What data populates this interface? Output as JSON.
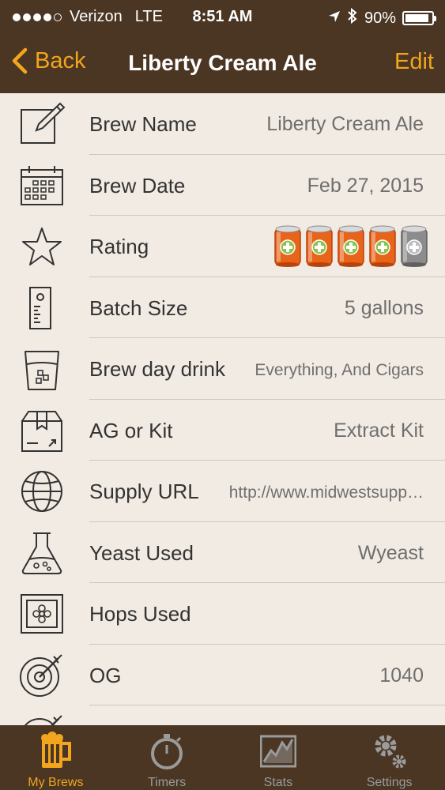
{
  "status_bar": {
    "carrier": "Verizon",
    "network": "LTE",
    "time": "8:51 AM",
    "battery": "90%",
    "battery_level": 0.9
  },
  "nav": {
    "back_label": "Back",
    "title": "Liberty Cream Ale",
    "edit_label": "Edit"
  },
  "rows": [
    {
      "label": "Brew Name",
      "value": "Liberty Cream Ale",
      "icon": "pencil-square-icon"
    },
    {
      "label": "Brew Date",
      "value": "Feb 27, 2015",
      "icon": "calendar-icon"
    },
    {
      "label": "Rating",
      "icon": "star-icon",
      "rating": 4,
      "rating_max": 5
    },
    {
      "label": "Batch Size",
      "value": "5 gallons",
      "icon": "measure-icon"
    },
    {
      "label": "Brew day drink",
      "value": "Everything, And Cigars",
      "icon": "glass-icon"
    },
    {
      "label": "AG or Kit",
      "value": "Extract Kit",
      "icon": "box-icon"
    },
    {
      "label": "Supply URL",
      "value": "http://www.midwestsupp…",
      "icon": "globe-icon"
    },
    {
      "label": "Yeast Used",
      "value": "Wyeast",
      "icon": "flask-icon"
    },
    {
      "label": "Hops Used",
      "value": "",
      "icon": "hops-icon"
    },
    {
      "label": "OG",
      "value": "1040",
      "icon": "target-icon"
    }
  ],
  "tabs": [
    {
      "label": "My Brews",
      "icon": "beer-mug-icon",
      "active": true
    },
    {
      "label": "Timers",
      "icon": "stopwatch-icon",
      "active": false
    },
    {
      "label": "Stats",
      "icon": "chart-icon",
      "active": false
    },
    {
      "label": "Settings",
      "icon": "gears-icon",
      "active": false
    }
  ],
  "colors": {
    "bar_brown": "#4a3623",
    "accent_orange": "#f2a51d",
    "background": "#f2ebe3"
  }
}
